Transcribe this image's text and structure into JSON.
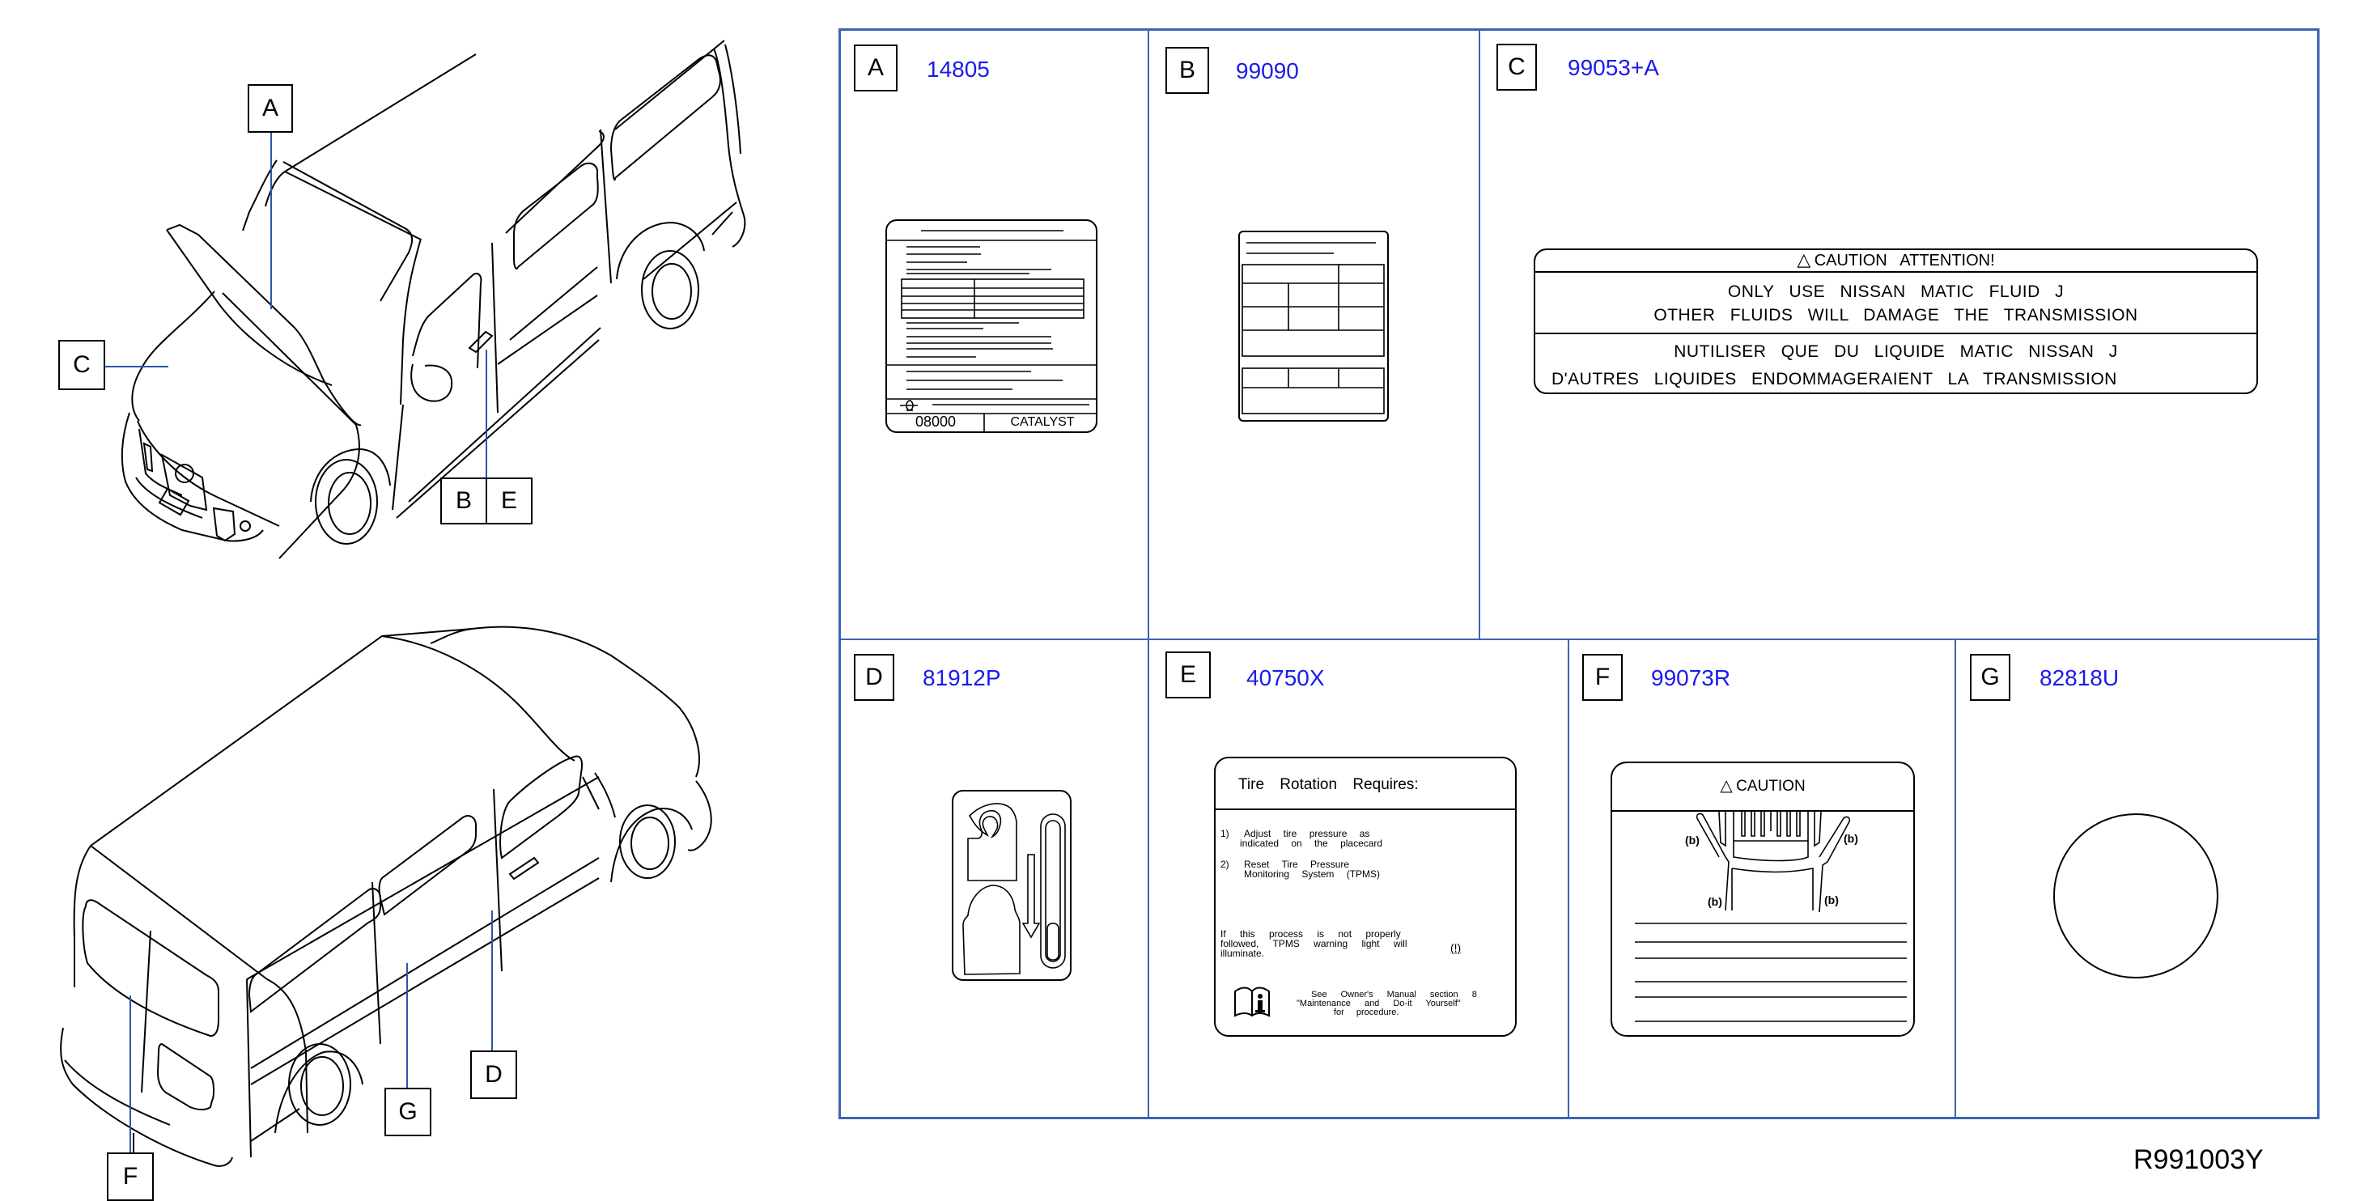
{
  "diagram": {
    "reference_code": "R991003Y",
    "vehicle_views": {
      "front_view": {
        "callouts": [
          "A",
          "C",
          "B",
          "E"
        ]
      },
      "rear_view": {
        "callouts": [
          "F",
          "G",
          "D"
        ]
      }
    },
    "labels": [
      {
        "letter": "A",
        "part_number": "14805",
        "content": {
          "footer_left": "08000",
          "footer_right": "CATALYST"
        }
      },
      {
        "letter": "B",
        "part_number": "99090"
      },
      {
        "letter": "C",
        "part_number": "99053+A",
        "content": {
          "header": "CAUTION   ATTENTION!",
          "english_line1": "ONLY USE NISSAN MATIC FLUID J",
          "english_line2": "OTHER FLUIDS WILL DAMAGE THE TRANSMISSION",
          "french_line1": "NUTILISER QUE DU LIQUIDE MATIC NISSAN J",
          "french_line2": "D'AUTRES LIQUIDES ENDOMMAGERAIENT LA TRANSMISSION"
        }
      },
      {
        "letter": "D",
        "part_number": "81912P"
      },
      {
        "letter": "E",
        "part_number": "40750X",
        "content": {
          "title": "Tire Rotation Requires:",
          "step1_num": "1)",
          "step1_line1": "Adjust tire pressure as",
          "step1_line2": "indicated on the placecard",
          "step2_num": "2)",
          "step2_line1": "Reset Tire Pressure",
          "step2_line2": "Monitoring System (TPMS)",
          "warning_line1": "If this process is not properly",
          "warning_line2": "followed, TPMS warning light will",
          "warning_line3": "illuminate.",
          "tpms_symbol": "(!)",
          "manual_line1": "See Owner's Manual section 8",
          "manual_line2": "\"Maintenance and Do-it Yourself\"",
          "manual_line3": "for procedure."
        }
      },
      {
        "letter": "F",
        "part_number": "99073R",
        "content": {
          "header": "CAUTION",
          "marker": "(b)"
        }
      },
      {
        "letter": "G",
        "part_number": "82818U"
      }
    ],
    "colors": {
      "part_number": "#1a1aee",
      "grid": "#3c64b0",
      "leader": "#2a56a8"
    }
  }
}
